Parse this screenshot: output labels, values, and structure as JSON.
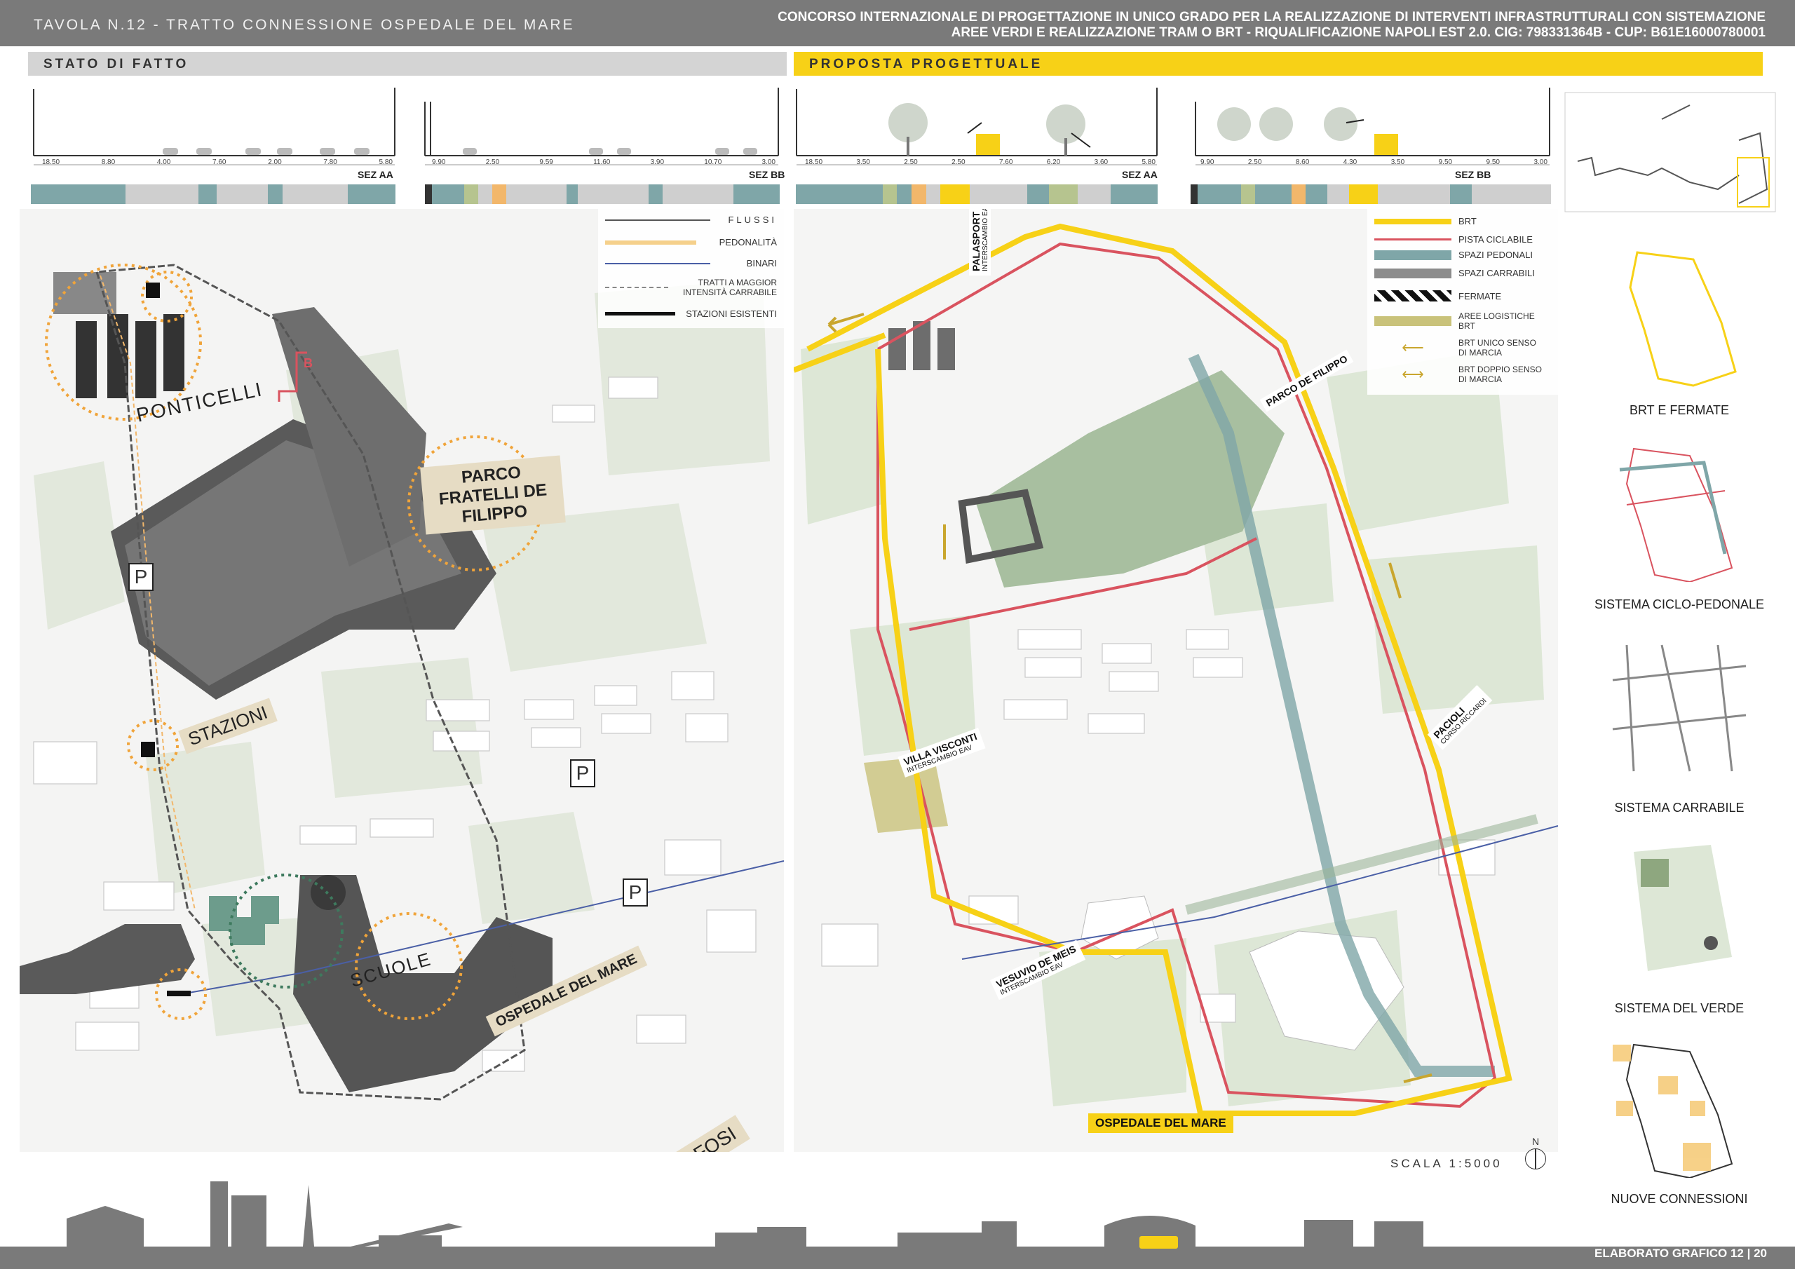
{
  "header": {
    "title": "TAVOLA N.12 - TRATTO CONNESSIONE OSPEDALE DEL MARE",
    "competition_line1": "CONCORSO INTERNAZIONALE DI PROGETTAZIONE IN UNICO GRADO PER LA REALIZZAZIONE DI INTERVENTI INFRASTRUTTURALI CON SISTEMAZIONE",
    "competition_line2": "AREE VERDI E REALIZZAZIONE TRAM O BRT - RIQUALIFICAZIONE NAPOLI EST 2.0. CIG: 798331364B - CUP: B61E16000780001"
  },
  "left_panel": {
    "band_label": "STATO DI FATTO",
    "section_aa": {
      "label": "SEZ AA",
      "dims": [
        "18.50",
        "8.80",
        "4.00",
        "7.60",
        "2.00",
        "7.80",
        "5.80"
      ]
    },
    "section_bb": {
      "label": "SEZ BB",
      "dims": [
        "9.90",
        "2.50",
        "9.59",
        "11.60",
        "3.90",
        "10.70",
        "3.00"
      ]
    },
    "legend": [
      {
        "label": "FLUSSI"
      },
      {
        "label": "PEDONALITÀ"
      },
      {
        "label": "BINARI"
      },
      {
        "label": "TRATTI A MAGGIOR INTENSITÀ CARRABILE"
      },
      {
        "label": "STAZIONI ESISTENTI"
      }
    ],
    "place_labels": {
      "ponticelli": "PONTICELLI",
      "parco": "PARCO FRATELLI DE FILIPPO",
      "stazioni": "STAZIONI",
      "scuole": "SCUOLE",
      "ospedale": "OSPEDALE DEL MARE",
      "viale": "VIALE DELLE METAMORFOSI"
    },
    "parking_letter": "P",
    "section_marker": "B"
  },
  "right_panel": {
    "band_label": "PROPOSTA PROGETTUALE",
    "section_aa": {
      "label": "SEZ AA",
      "dims": [
        "18.50",
        "3.50",
        "2.50",
        "2.50",
        "7.60",
        "6.20",
        "3.60",
        "5.80"
      ]
    },
    "section_bb": {
      "label": "SEZ BB",
      "dims": [
        "9.90",
        "2.50",
        "8.60",
        "4.30",
        "3.50",
        "9.50",
        "9.50",
        "3.00"
      ]
    },
    "legend": [
      {
        "label": "BRT",
        "color": "#f7d117"
      },
      {
        "label": "PISTA CICLABILE",
        "color": "#d9535f"
      },
      {
        "label": "SPAZI PEDONALI",
        "color": "#7fa6a8"
      },
      {
        "label": "SPAZI CARRABILI",
        "color": "#8c8c8c"
      },
      {
        "label": "FERMATE"
      },
      {
        "label": "AREE LOGISTICHE BRT",
        "color": "#c9c27a"
      },
      {
        "label": "BRT UNICO SENSO DI MARCIA"
      },
      {
        "label": "BRT DOPPIO SENSO DI MARCIA"
      }
    ],
    "stations": {
      "palasport": {
        "name": "PALASPORT",
        "sub": "INTERSCAMBIO EAV"
      },
      "parco": {
        "name": "PARCO DE FILIPPO"
      },
      "villa": {
        "name": "VILLA VISCONTI",
        "sub": "INTERSCAMBIO EAV"
      },
      "pacioli": {
        "name": "PACIOLI",
        "sub": "CORSO RICCARDI"
      },
      "vesuvio": {
        "name": "VESUVIO DE MEIS",
        "sub": "INTERSCAMBIO EAV"
      },
      "ospedale": {
        "name": "OSPEDALE DEL MARE"
      }
    },
    "scale": "SCALA 1:5000",
    "north": "N"
  },
  "sidebar": {
    "captions": [
      "BRT E FERMATE",
      "SISTEMA CICLO-PEDONALE",
      "SISTEMA CARRABILE",
      "SISTEMA DEL VERDE",
      "NUOVE CONNESSIONI"
    ]
  },
  "footer": {
    "label": "ELABORATO GRAFICO 12 | 20"
  },
  "colors": {
    "brt_yellow": "#f7d117",
    "cycle_red": "#d9535f",
    "pedestrian_teal": "#7fa6a8",
    "header_gray": "#7a7a7a",
    "band_gray": "#d4d4d4"
  }
}
